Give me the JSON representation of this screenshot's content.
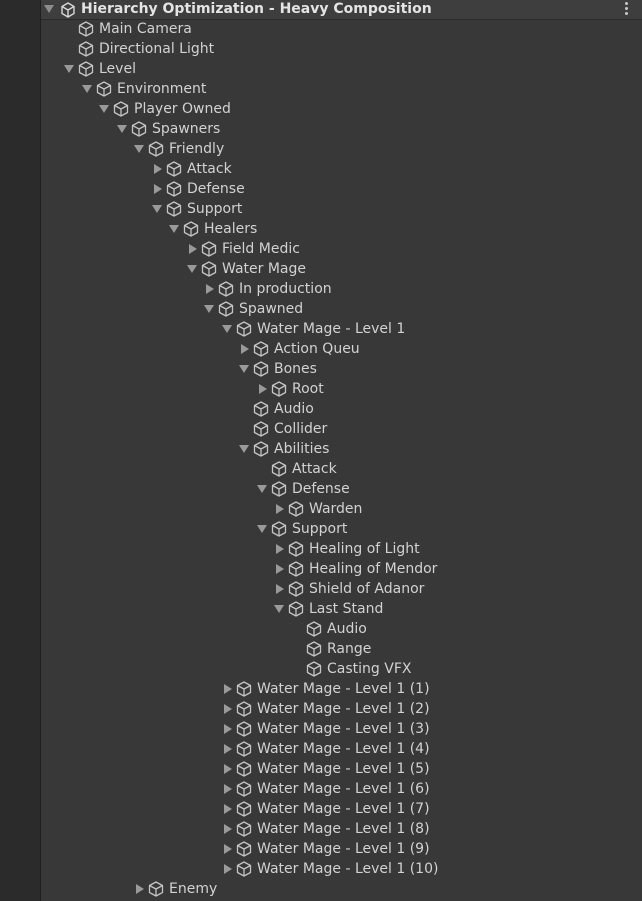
{
  "header": {
    "title": "Hierarchy Optimization - Heavy Composition",
    "scene_icon": "unity-scene-icon",
    "menu_icon": "kebab-menu-icon"
  },
  "colors": {
    "panel_bg": "#383838",
    "gutter_bg": "#2b2b2b",
    "text": "#d2d2d2",
    "arrow": "#9a9a9a",
    "icon": "#c4c4c4"
  },
  "rows": [
    {
      "label": "Main Camera",
      "depth": 0,
      "arrow": "none"
    },
    {
      "label": "Directional Light",
      "depth": 0,
      "arrow": "none"
    },
    {
      "label": "Level",
      "depth": 0,
      "arrow": "open"
    },
    {
      "label": "Environment",
      "depth": 1,
      "arrow": "open"
    },
    {
      "label": "Player Owned",
      "depth": 2,
      "arrow": "open"
    },
    {
      "label": "Spawners",
      "depth": 3,
      "arrow": "open"
    },
    {
      "label": "Friendly",
      "depth": 4,
      "arrow": "open"
    },
    {
      "label": "Attack",
      "depth": 5,
      "arrow": "closed"
    },
    {
      "label": "Defense",
      "depth": 5,
      "arrow": "closed"
    },
    {
      "label": "Support",
      "depth": 5,
      "arrow": "open"
    },
    {
      "label": "Healers",
      "depth": 6,
      "arrow": "open"
    },
    {
      "label": "Field Medic",
      "depth": 7,
      "arrow": "closed"
    },
    {
      "label": "Water Mage",
      "depth": 7,
      "arrow": "open"
    },
    {
      "label": "In production",
      "depth": 8,
      "arrow": "closed"
    },
    {
      "label": "Spawned",
      "depth": 8,
      "arrow": "open"
    },
    {
      "label": "Water Mage - Level 1",
      "depth": 9,
      "arrow": "open"
    },
    {
      "label": "Action Queu",
      "depth": 10,
      "arrow": "closed"
    },
    {
      "label": "Bones",
      "depth": 10,
      "arrow": "open"
    },
    {
      "label": "Root",
      "depth": 11,
      "arrow": "closed"
    },
    {
      "label": "Audio",
      "depth": 10,
      "arrow": "none"
    },
    {
      "label": "Collider",
      "depth": 10,
      "arrow": "none"
    },
    {
      "label": "Abilities",
      "depth": 10,
      "arrow": "open"
    },
    {
      "label": "Attack",
      "depth": 11,
      "arrow": "none"
    },
    {
      "label": "Defense",
      "depth": 11,
      "arrow": "open"
    },
    {
      "label": "Warden",
      "depth": 12,
      "arrow": "closed"
    },
    {
      "label": "Support",
      "depth": 11,
      "arrow": "open"
    },
    {
      "label": "Healing of Light",
      "depth": 12,
      "arrow": "closed"
    },
    {
      "label": "Healing of Mendor",
      "depth": 12,
      "arrow": "closed"
    },
    {
      "label": "Shield of Adanor",
      "depth": 12,
      "arrow": "closed"
    },
    {
      "label": "Last Stand",
      "depth": 12,
      "arrow": "open"
    },
    {
      "label": "Audio",
      "depth": 13,
      "arrow": "none"
    },
    {
      "label": "Range",
      "depth": 13,
      "arrow": "none"
    },
    {
      "label": "Casting VFX",
      "depth": 13,
      "arrow": "none"
    },
    {
      "label": "Water Mage - Level 1 (1)",
      "depth": 9,
      "arrow": "closed"
    },
    {
      "label": "Water Mage - Level 1 (2)",
      "depth": 9,
      "arrow": "closed"
    },
    {
      "label": "Water Mage - Level 1 (3)",
      "depth": 9,
      "arrow": "closed"
    },
    {
      "label": "Water Mage - Level 1 (4)",
      "depth": 9,
      "arrow": "closed"
    },
    {
      "label": "Water Mage - Level 1 (5)",
      "depth": 9,
      "arrow": "closed"
    },
    {
      "label": "Water Mage - Level 1 (6)",
      "depth": 9,
      "arrow": "closed"
    },
    {
      "label": "Water Mage - Level 1 (7)",
      "depth": 9,
      "arrow": "closed"
    },
    {
      "label": "Water Mage - Level 1 (8)",
      "depth": 9,
      "arrow": "closed"
    },
    {
      "label": "Water Mage - Level 1 (9)",
      "depth": 9,
      "arrow": "closed"
    },
    {
      "label": "Water Mage - Level 1 (10)",
      "depth": 9,
      "arrow": "closed"
    },
    {
      "label": "Enemy",
      "depth": 4,
      "arrow": "closed"
    }
  ]
}
